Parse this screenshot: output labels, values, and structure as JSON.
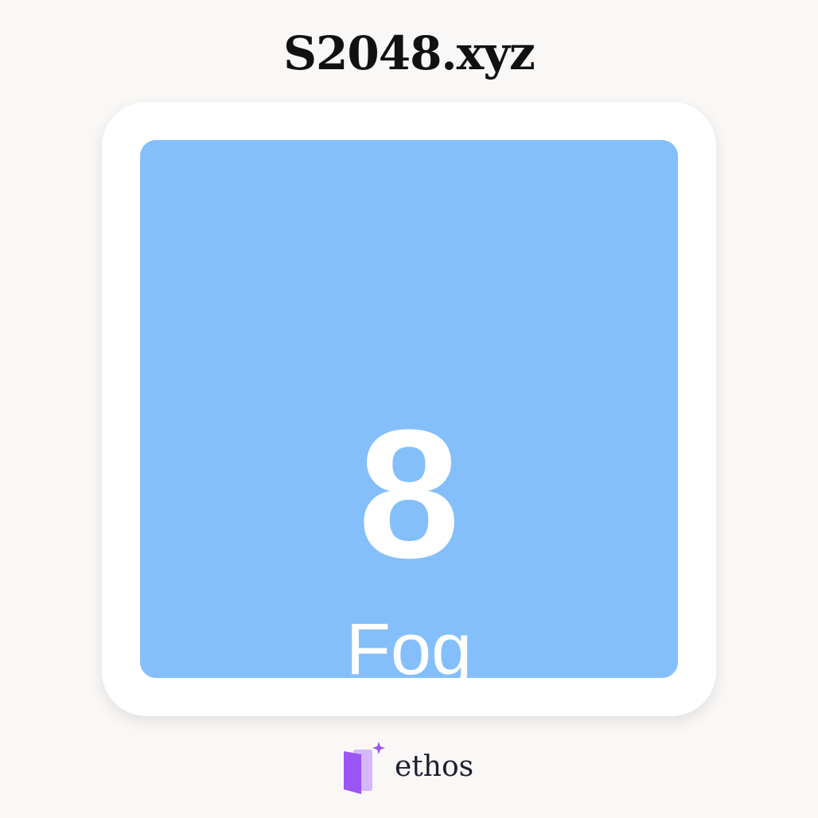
{
  "site": {
    "title": "S2048.xyz"
  },
  "tile": {
    "value": "8",
    "name": "Fog",
    "color": "#84bffc",
    "text_color": "#ffffff"
  },
  "card": {
    "background": "#ffffff"
  },
  "brand": {
    "name": "ethos",
    "icon": "book-sparkle-icon",
    "accent": "#9b5cf6"
  }
}
